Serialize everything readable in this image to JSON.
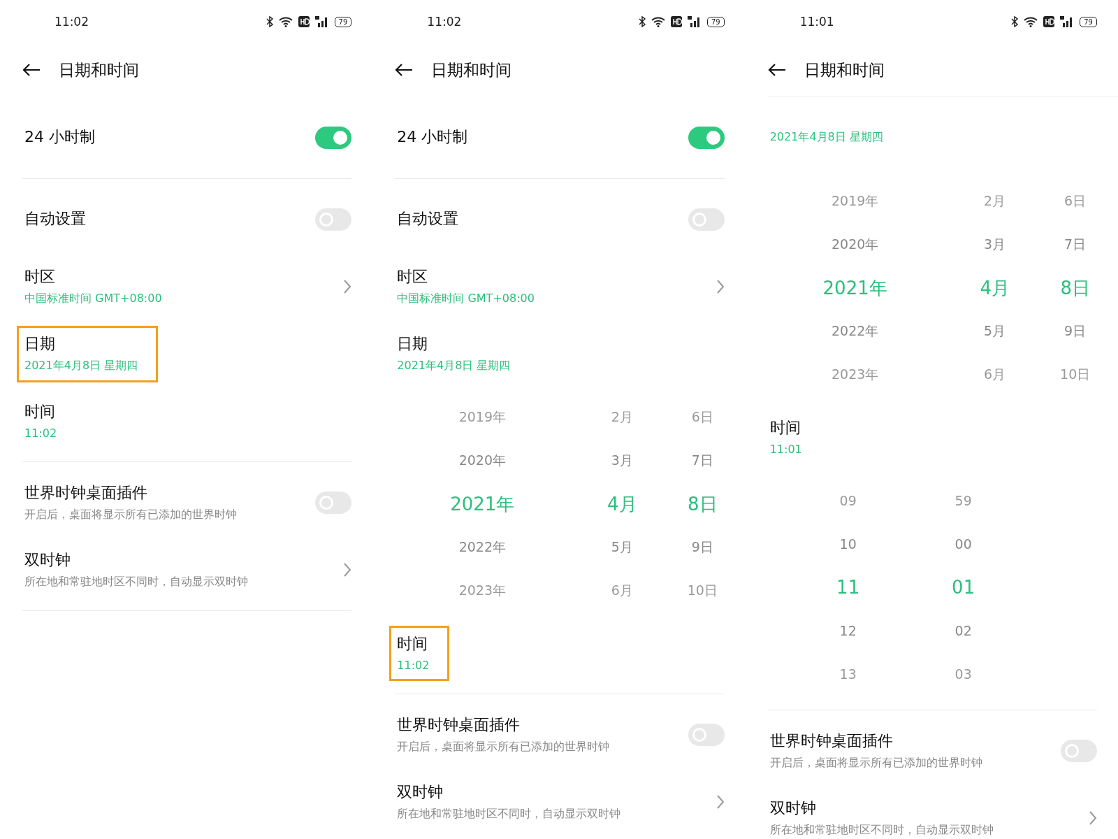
{
  "panels": [
    {
      "status": {
        "time": "11:02",
        "battery": "79"
      },
      "header": {
        "title": "日期和时间"
      },
      "sections": [
        [
          {
            "kind": "toggle",
            "label": "24 小时制",
            "on": true
          }
        ],
        [
          {
            "kind": "toggle",
            "label": "自动设置",
            "on": false
          },
          {
            "kind": "link",
            "label": "时区",
            "value": "中国标准时间 GMT+08:00"
          },
          {
            "kind": "info",
            "label": "日期",
            "value": "2021年4月8日 星期四",
            "highlighted": true
          },
          {
            "kind": "info",
            "label": "时间",
            "value": "11:02"
          }
        ],
        [
          {
            "kind": "toggle",
            "label": "世界时钟桌面插件",
            "note": "开启后，桌面将显示所有已添加的世界时钟",
            "on": false
          },
          {
            "kind": "link",
            "label": "双时钟",
            "note": "所在地和常驻地时区不同时，自动显示双时钟"
          }
        ]
      ]
    },
    {
      "status": {
        "time": "11:02",
        "battery": "79"
      },
      "header": {
        "title": "日期和时间"
      },
      "sections": [
        [
          {
            "kind": "toggle",
            "label": "24 小时制",
            "on": true
          }
        ],
        [
          {
            "kind": "toggle",
            "label": "自动设置",
            "on": false
          },
          {
            "kind": "link",
            "label": "时区",
            "value": "中国标准时间 GMT+08:00"
          },
          {
            "kind": "info",
            "label": "日期",
            "value": "2021年4月8日 星期四"
          },
          {
            "kind": "picker",
            "columns": [
              {
                "items": [
                  {
                    "text": "2019年",
                    "selected": false
                  },
                  {
                    "text": "2020年",
                    "selected": false
                  },
                  {
                    "text": "2021年",
                    "selected": true
                  },
                  {
                    "text": "2022年",
                    "selected": false
                  },
                  {
                    "text": "2023年",
                    "selected": false
                  }
                ]
              },
              {
                "items": [
                  {
                    "text": "2月",
                    "selected": false
                  },
                  {
                    "text": "3月",
                    "selected": false
                  },
                  {
                    "text": "4月",
                    "selected": true
                  },
                  {
                    "text": "5月",
                    "selected": false
                  },
                  {
                    "text": "6月",
                    "selected": false
                  }
                ]
              },
              {
                "items": [
                  {
                    "text": "6日",
                    "selected": false
                  },
                  {
                    "text": "7日",
                    "selected": false
                  },
                  {
                    "text": "8日",
                    "selected": true
                  },
                  {
                    "text": "9日",
                    "selected": false
                  },
                  {
                    "text": "10日",
                    "selected": false
                  }
                ]
              }
            ]
          },
          {
            "kind": "info",
            "label": "时间",
            "value": "11:02",
            "highlighted": true
          }
        ],
        [
          {
            "kind": "toggle",
            "label": "世界时钟桌面插件",
            "note": "开启后，桌面将显示所有已添加的世界时钟",
            "on": false
          },
          {
            "kind": "link",
            "label": "双时钟",
            "note": "所在地和常驻地时区不同时，自动显示双时钟"
          }
        ]
      ]
    },
    {
      "status": {
        "time": "11:01",
        "battery": "79"
      },
      "header": {
        "title": "日期和时间",
        "scrolled": true
      },
      "sections": [
        [
          {
            "kind": "info",
            "value": "2021年4月8日 星期四"
          },
          {
            "kind": "picker",
            "columns": [
              {
                "items": [
                  {
                    "text": "2019年",
                    "selected": false
                  },
                  {
                    "text": "2020年",
                    "selected": false
                  },
                  {
                    "text": "2021年",
                    "selected": true
                  },
                  {
                    "text": "2022年",
                    "selected": false
                  },
                  {
                    "text": "2023年",
                    "selected": false
                  }
                ]
              },
              {
                "items": [
                  {
                    "text": "2月",
                    "selected": false
                  },
                  {
                    "text": "3月",
                    "selected": false
                  },
                  {
                    "text": "4月",
                    "selected": true
                  },
                  {
                    "text": "5月",
                    "selected": false
                  },
                  {
                    "text": "6月",
                    "selected": false
                  }
                ]
              },
              {
                "items": [
                  {
                    "text": "6日",
                    "selected": false
                  },
                  {
                    "text": "7日",
                    "selected": false
                  },
                  {
                    "text": "8日",
                    "selected": true
                  },
                  {
                    "text": "9日",
                    "selected": false
                  },
                  {
                    "text": "10日",
                    "selected": false
                  }
                ]
              }
            ]
          },
          {
            "kind": "info",
            "label": "时间",
            "value": "11:01"
          },
          {
            "kind": "picker",
            "columns": [
              {
                "items": [
                  {
                    "text": "09",
                    "selected": false
                  },
                  {
                    "text": "10",
                    "selected": false
                  },
                  {
                    "text": "11",
                    "selected": true
                  },
                  {
                    "text": "12",
                    "selected": false
                  },
                  {
                    "text": "13",
                    "selected": false
                  }
                ]
              },
              {
                "items": [
                  {
                    "text": "59",
                    "selected": false
                  },
                  {
                    "text": "00",
                    "selected": false
                  },
                  {
                    "text": "01",
                    "selected": true
                  },
                  {
                    "text": "02",
                    "selected": false
                  },
                  {
                    "text": "03",
                    "selected": false
                  }
                ]
              }
            ]
          }
        ],
        [
          {
            "kind": "toggle",
            "label": "世界时钟桌面插件",
            "note": "开启后，桌面将显示所有已添加的世界时钟",
            "on": false
          },
          {
            "kind": "link",
            "label": "双时钟",
            "note": "所在地和常驻地时区不同时，自动显示双时钟"
          }
        ]
      ]
    }
  ]
}
